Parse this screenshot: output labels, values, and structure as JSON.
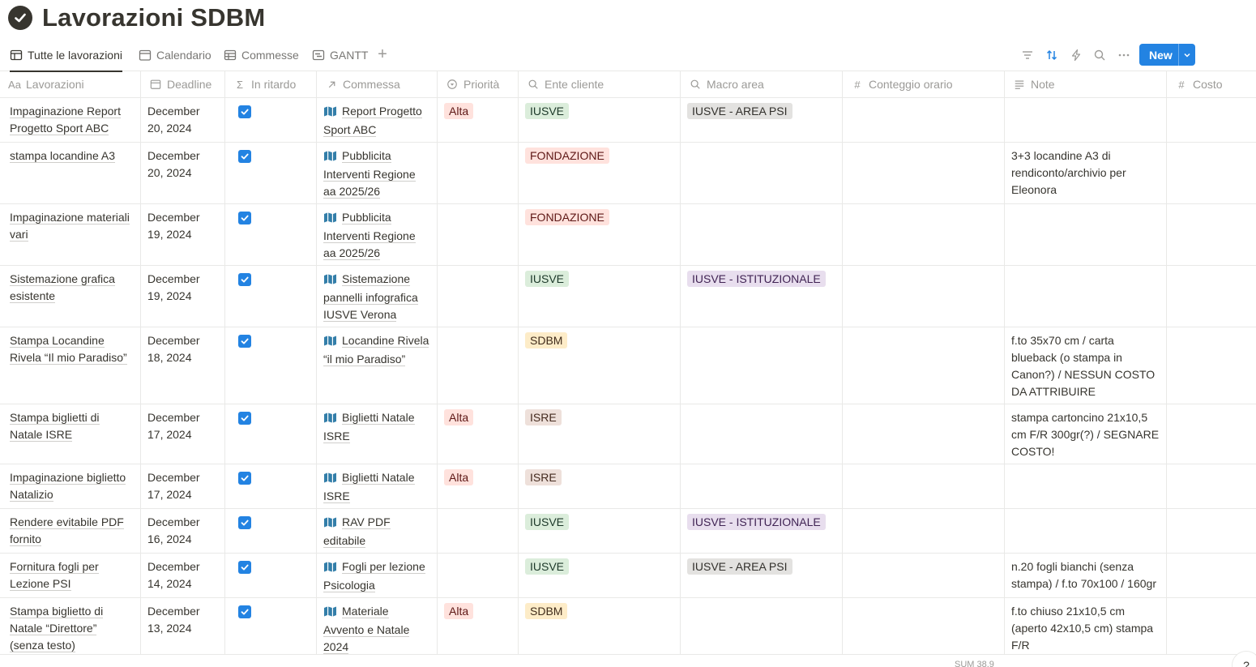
{
  "page": {
    "title": "Lavorazioni SDBM"
  },
  "views": [
    {
      "label": "Tutte le lavorazioni",
      "icon": "table-icon",
      "active": true
    },
    {
      "label": "Calendario",
      "icon": "calendar-icon",
      "active": false
    },
    {
      "label": "Commesse",
      "icon": "table-icon",
      "active": false
    },
    {
      "label": "GANTT",
      "icon": "timeline-icon",
      "active": false
    }
  ],
  "toolbar": {
    "new_label": "New"
  },
  "columns": [
    {
      "label": "Lavorazioni",
      "icon": "Aa"
    },
    {
      "label": "Deadline",
      "icon": "calendar-icon"
    },
    {
      "label": "In ritardo",
      "icon": "Σ"
    },
    {
      "label": "Commessa",
      "icon": "relation-arrow-icon"
    },
    {
      "label": "Priorità",
      "icon": "select-icon"
    },
    {
      "label": "Ente cliente",
      "icon": "search-icon"
    },
    {
      "label": "Macro area",
      "icon": "search-icon"
    },
    {
      "label": "Conteggio orario",
      "icon": "#"
    },
    {
      "label": "Note",
      "icon": "text-lines-icon"
    },
    {
      "label": "Costo",
      "icon": "#"
    }
  ],
  "rows": [
    {
      "name": "Impaginazione Report Progetto Sport ABC",
      "deadline": "December 20, 2024",
      "late": true,
      "commessa": "Report Progetto Sport ABC",
      "priority": "Alta",
      "client": "IUSVE",
      "macro": "IUSVE - AREA PSI",
      "note": ""
    },
    {
      "name": "stampa locandine A3",
      "deadline": "December 20, 2024",
      "late": true,
      "commessa": "Pubblicita Interventi Regione aa 2025/26",
      "priority": "",
      "client": "FONDAZIONE",
      "macro": "",
      "note": "3+3 locandine A3 di rendiconto/archivio per Eleonora"
    },
    {
      "name": "Impaginazione materiali vari",
      "deadline": "December 19, 2024",
      "late": true,
      "commessa": "Pubblicita Interventi Regione aa 2025/26",
      "priority": "",
      "client": "FONDAZIONE",
      "macro": "",
      "note": ""
    },
    {
      "name": "Sistemazione grafica esistente",
      "deadline": "December 19, 2024",
      "late": true,
      "commessa": "Sistemazione pannelli infografica IUSVE Verona",
      "priority": "",
      "client": "IUSVE",
      "macro": "IUSVE - ISTITUZIONALE",
      "note": ""
    },
    {
      "name": "Stampa Locandine Rivela “Il mio Paradiso”",
      "deadline": "December 18, 2024",
      "late": true,
      "commessa": "Locandine Rivela “il mio Paradiso”",
      "priority": "",
      "client": "SDBM",
      "macro": "",
      "note": "f.to 35x70 cm / carta blueback (o stampa in Canon?) / NESSUN COSTO DA ATTRIBUIRE"
    },
    {
      "name": "Stampa biglietti di Natale ISRE",
      "deadline": "December 17, 2024",
      "late": true,
      "commessa": "Biglietti Natale ISRE",
      "priority": "Alta",
      "client": "ISRE",
      "macro": "",
      "note": "stampa cartoncino 21x10,5 cm F/R 300gr(?) / SEGNARE COSTO!"
    },
    {
      "name": "Impaginazione biglietto Natalizio",
      "deadline": "December 17, 2024",
      "late": true,
      "commessa": "Biglietti Natale ISRE",
      "priority": "Alta",
      "client": "ISRE",
      "macro": "",
      "note": ""
    },
    {
      "name": "Rendere evitabile PDF fornito",
      "deadline": "December 16, 2024",
      "late": true,
      "commessa": "RAV PDF editabile",
      "priority": "",
      "client": "IUSVE",
      "macro": "IUSVE - ISTITUZIONALE",
      "note": ""
    },
    {
      "name": "Fornitura fogli per Lezione PSI",
      "deadline": "December 14, 2024",
      "late": true,
      "commessa": "Fogli per lezione Psicologia",
      "priority": "",
      "client": "IUSVE",
      "macro": "IUSVE - AREA PSI",
      "note": "n.20 fogli bianchi (senza stampa) / f.to 70x100 / 160gr"
    },
    {
      "name": "Stampa biglietto di Natale “Direttore” (senza testo)",
      "deadline": "December 13, 2024",
      "late": true,
      "commessa": "Materiale Avvento e Natale 2024",
      "priority": "Alta",
      "client": "SDBM",
      "macro": "",
      "note": "f.to chiuso 21x10,5 cm (aperto 42x10,5 cm) stampa F/R"
    }
  ],
  "tag_colors": {
    "Alta": {
      "bg": "#ffe2dd",
      "fg": "#5d1715"
    },
    "IUSVE": {
      "bg": "#dbeddb",
      "fg": "#1c3829"
    },
    "FONDAZIONE": {
      "bg": "#ffe2dd",
      "fg": "#5d1715"
    },
    "SDBM": {
      "bg": "#fdecc8",
      "fg": "#402c1b"
    },
    "ISRE": {
      "bg": "#eee0da",
      "fg": "#442a1e"
    },
    "IUSVE - AREA PSI": {
      "bg": "#e3e2e0",
      "fg": "#32302c"
    },
    "IUSVE - ISTITUZIONALE": {
      "bg": "#e8deee",
      "fg": "#412454"
    }
  },
  "footer": {
    "sum_text": "SUM 38.9"
  },
  "help_label": "?"
}
